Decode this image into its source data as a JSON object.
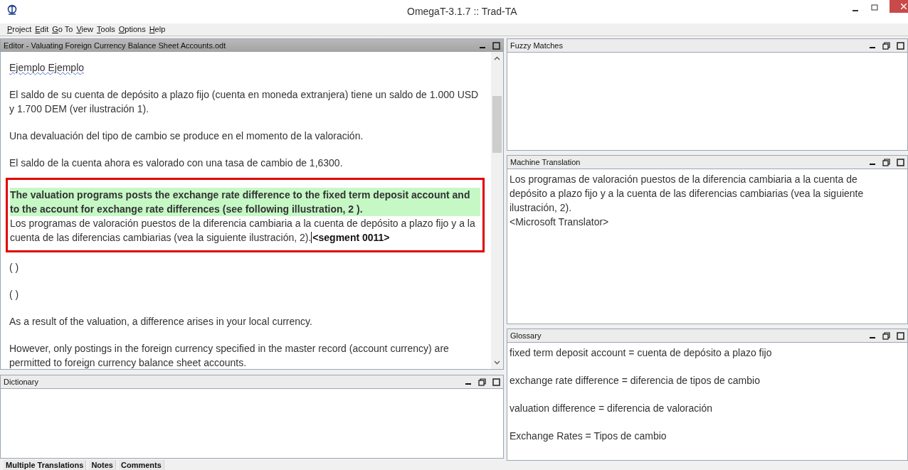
{
  "window": {
    "title": "OmegaT-3.1.7 :: Trad-TA"
  },
  "menu": [
    "Project",
    "Edit",
    "Go To",
    "View",
    "Tools",
    "Options",
    "Help"
  ],
  "editor": {
    "title": "Editor - Valuating Foreign Currency Balance Sheet Accounts.odt",
    "segments": [
      {
        "kind": "text",
        "text": "Ejemplo Ejemplo",
        "misspelled": true
      },
      {
        "kind": "text",
        "text": "El saldo de su cuenta de depósito a plazo fijo (cuenta en moneda extranjera) tiene un saldo de 1.000 USD y 1.700 DEM (ver ilustración 1).",
        "misspelled": false
      },
      {
        "kind": "text",
        "text": "Una devaluación del tipo de cambio se produce en el momento de la valoración.",
        "misspelled": false
      },
      {
        "kind": "text",
        "text": "El saldo de la cuenta ahora es valorado con una tasa de cambio de 1,6300.",
        "misspelled": false
      },
      {
        "kind": "active",
        "source": "The valuation programs posts the exchange rate difference to the fixed term deposit account and to the account for exchange rate differences (see following illustration, 2 ).",
        "target": "Los programas de valoración puestos de la diferencia cambiaria a la cuenta de depósito a plazo fijo y a la cuenta de las diferencias cambiarias (vea la siguiente ilustración, 2).",
        "marker": "<segment 0011>"
      },
      {
        "kind": "text",
        "text": "( )",
        "misspelled": false
      },
      {
        "kind": "text",
        "text": "( )",
        "misspelled": false
      },
      {
        "kind": "text",
        "text": "As a result of the valuation, a difference arises in your local currency.",
        "misspelled": false
      },
      {
        "kind": "text",
        "text": "However, only postings in the foreign currency specified in the master record (account currency) are permitted to foreign currency balance sheet accounts.",
        "misspelled": false
      }
    ]
  },
  "dictionary": {
    "title": "Dictionary"
  },
  "fuzzy_matches": {
    "title": "Fuzzy Matches"
  },
  "machine_translation": {
    "title": "Machine Translation",
    "lines": [
      "Los programas de valoración puestos de la diferencia cambiaria a la cuenta de depósito a plazo fijo y a la cuenta de las diferencias cambiarias (vea la siguiente ilustración, 2).",
      "<Microsoft Translator>"
    ]
  },
  "glossary": {
    "title": "Glossary",
    "entries": [
      "fixed term deposit account = cuenta de depósito a plazo fijo",
      "exchange rate difference = diferencia de tipos de cambio",
      "valuation difference = diferencia de valoración",
      "Exchange Rates = Tipos de cambio"
    ]
  },
  "bottom_tabs": [
    "Multiple Translations",
    "Notes",
    "Comments"
  ]
}
